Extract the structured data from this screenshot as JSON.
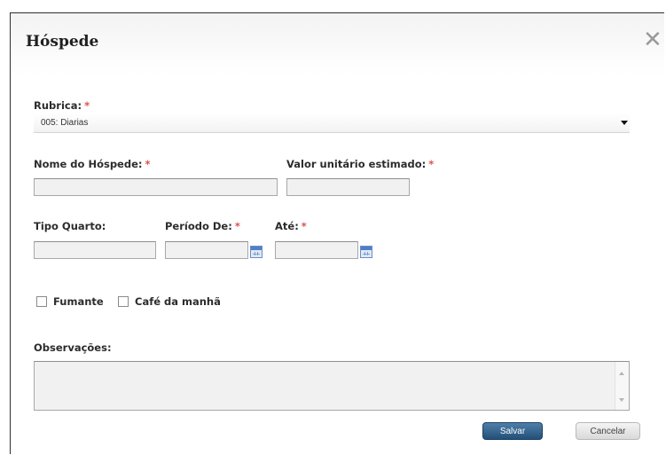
{
  "dialog": {
    "title": "Hóspede",
    "close_symbol": "✕"
  },
  "form": {
    "rubrica": {
      "label": "Rubrica:",
      "required_mark": "*",
      "selected": "005: Diarias"
    },
    "nome_hospede": {
      "label": "Nome do Hóspede:",
      "required_mark": "*",
      "value": ""
    },
    "valor_unitario": {
      "label": "Valor unitário estimado:",
      "required_mark": "*",
      "value": ""
    },
    "tipo_quarto": {
      "label": "Tipo Quarto:",
      "value": ""
    },
    "periodo_de": {
      "label": "Período De:",
      "required_mark": "*",
      "value": ""
    },
    "ate": {
      "label": "Até:",
      "required_mark": "*",
      "value": ""
    },
    "fumante": {
      "label": "Fumante",
      "checked": false
    },
    "cafe_da_manha": {
      "label": "Café da manhã",
      "checked": false
    },
    "observacoes": {
      "label": "Observações:",
      "value": ""
    }
  },
  "buttons": {
    "save": "Salvar",
    "cancel": "Cancelar"
  },
  "icons": {
    "close": "close-icon",
    "calendar": "calendar-icon",
    "dropdown": "chevron-down-icon"
  },
  "colors": {
    "required": "#d9534f",
    "primary_button": "#2f5d87"
  }
}
